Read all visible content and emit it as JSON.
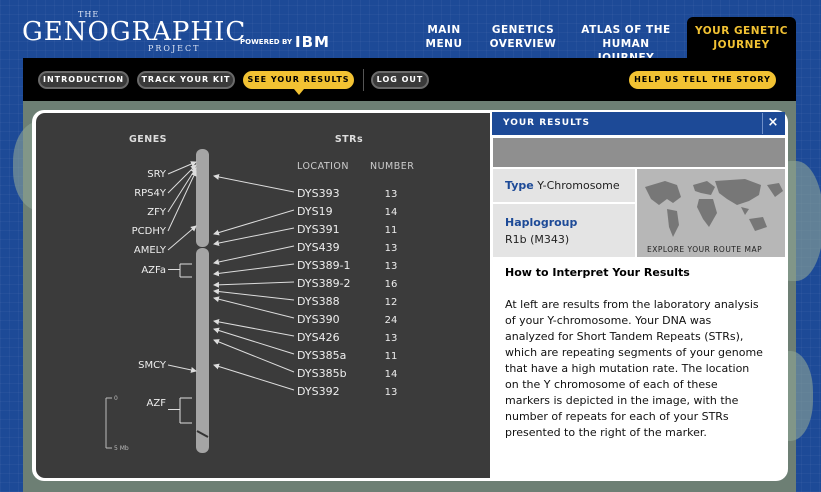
{
  "header": {
    "logo_the": "THE",
    "logo_name": "GENOGRAPHIC",
    "logo_project": "PROJECT",
    "powered_by": "POWERED BY",
    "sponsor": "IBM",
    "nav": [
      {
        "label": "MAIN MENU"
      },
      {
        "label": "GENETICS OVERVIEW"
      },
      {
        "label": "ATLAS OF THE HUMAN JOURNEY"
      },
      {
        "label": "YOUR GENETIC JOURNEY"
      }
    ]
  },
  "subnav": {
    "tabs": [
      {
        "label": "INTRODUCTION"
      },
      {
        "label": "TRACK YOUR KIT"
      },
      {
        "label": "SEE YOUR RESULTS"
      },
      {
        "label": "LOG OUT"
      }
    ],
    "help_button": "HELP US TELL THE STORY"
  },
  "results": {
    "header": "YOUR RESULTS",
    "close": "×",
    "type_label": "Type",
    "type_value": "Y-Chromosome",
    "haplogroup_label": "Haplogroup",
    "haplogroup_value": "R1b (M343)",
    "map_caption": "EXPLORE YOUR ROUTE MAP",
    "howto_title": "How to Interpret Your Results",
    "howto_body": "At left are results from the laboratory analysis of your Y-chromosome. Your DNA was analyzed for Short Tandem Repeats (STRs), which are repeating segments of your genome that have a high mutation rate. The location on the Y chromosome of each of these markers is depicted in the image, with the number of repeats for each of your STRs presented to the right of the marker."
  },
  "chart_data": {
    "type": "table",
    "genes_heading": "GENES",
    "strs_heading": "STRs",
    "location_heading": "LOCATION",
    "number_heading": "NUMBER",
    "genes": [
      "SRY",
      "RPS4Y",
      "ZFY",
      "PCDHY",
      "AMELY",
      "AZFa",
      "SMCY",
      "AZF"
    ],
    "strs": [
      {
        "location": "DYS393",
        "number": 13
      },
      {
        "location": "DYS19",
        "number": 14
      },
      {
        "location": "DYS391",
        "number": 11
      },
      {
        "location": "DYS439",
        "number": 13
      },
      {
        "location": "DYS389-1",
        "number": 13
      },
      {
        "location": "DYS389-2",
        "number": 16
      },
      {
        "location": "DYS388",
        "number": 12
      },
      {
        "location": "DYS390",
        "number": 24
      },
      {
        "location": "DYS426",
        "number": 13
      },
      {
        "location": "DYS385a",
        "number": 11
      },
      {
        "location": "DYS385b",
        "number": 14
      },
      {
        "location": "DYS392",
        "number": 13
      }
    ],
    "scale_top": "0",
    "scale_bottom": "5 Mb"
  },
  "colors": {
    "brand_blue": "#1d4a97",
    "accent_gold": "#f2c233",
    "chart_bg": "#3b3b3b"
  }
}
